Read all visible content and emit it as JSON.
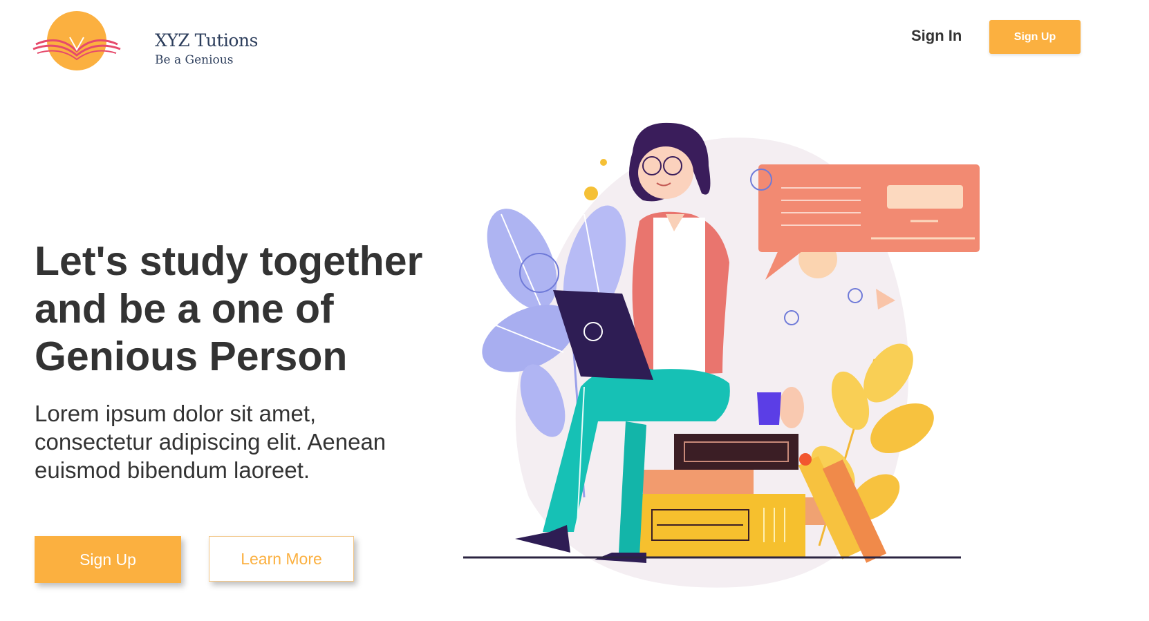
{
  "brand": {
    "name": "XYZ Tutions",
    "tagline": "Be a Genious"
  },
  "nav": {
    "sign_in_label": "Sign In",
    "sign_up_label": "Sign Up"
  },
  "hero": {
    "headline": "Let's study together and be a one of Genious Person",
    "description": "Lorem ipsum dolor sit amet, consectetur adipiscing elit. Aenean euismod bibendum laoreet.",
    "primary_button_label": "Sign Up",
    "secondary_button_label": "Learn More"
  },
  "colors": {
    "accent": "#fbb040",
    "text": "#333333",
    "brand_text": "#2d3e5c",
    "chat_bubble": "#f28a72"
  }
}
